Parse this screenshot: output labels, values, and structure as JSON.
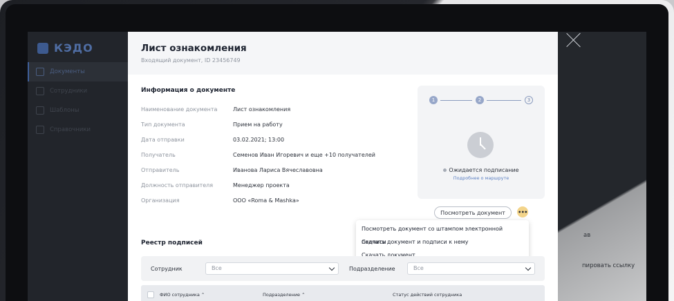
{
  "app": {
    "logo": "КЭДО",
    "nav": [
      {
        "label": "Документы",
        "active": true
      },
      {
        "label": "Сотрудники",
        "active": false
      },
      {
        "label": "Шаблоны",
        "active": false
      },
      {
        "label": "Справочники",
        "active": false
      }
    ],
    "background_link": "пировать ссылку",
    "background_label": "ав"
  },
  "modal": {
    "title": "Лист ознакомления",
    "subtitle": "Входящий документ, ID 23456749",
    "info_title": "Информация о документе",
    "info": [
      {
        "label": "Наименование документа",
        "value": "Лист ознакомления"
      },
      {
        "label": "Тип документа",
        "value": "Прием на работу"
      },
      {
        "label": "Дата отправки",
        "value": "03.02.2021; 13:00"
      },
      {
        "label": "Получатель",
        "value": "Семенов Иван Игоревич и еще +10 получателей"
      },
      {
        "label": "Отправитель",
        "value": "Иванова Лариса Вячеславовна"
      },
      {
        "label": "Должность отправителя",
        "value": "Менеджер проекта"
      },
      {
        "label": "Организация",
        "value": "ООО «Roma & Mashka»"
      }
    ],
    "route": {
      "steps": [
        "1",
        "2",
        "3"
      ],
      "current_step": 2,
      "status": "Ожидается подписание",
      "link": "Подробнее о маршруте"
    },
    "view_button": "Посмотреть документ",
    "more_button": "•••",
    "menu": [
      "Посмотреть документ со штампом электронной подписи",
      "Скачать документ и подписи к нему",
      "Скачать документ"
    ],
    "registry_title": "Реестр подписей",
    "filters": {
      "employee_label": "Сотрудник",
      "employee_value": "Все",
      "department_label": "Подразделение",
      "department_value": "Все"
    },
    "table_headers": [
      "ФИО сотрудника ⌃",
      "Подразделение ⌃",
      "Статус действий сотрудника"
    ]
  },
  "colors": {
    "accent": "#97a7c9",
    "more_button": "#f3d48a",
    "link": "#5b7fc2"
  }
}
